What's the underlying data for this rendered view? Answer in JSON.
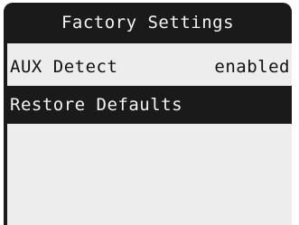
{
  "screen": {
    "title": "Factory Settings"
  },
  "menu": {
    "items": [
      {
        "label": "AUX Detect",
        "value": "enabled",
        "selected": false
      },
      {
        "label": "Restore Defaults",
        "value": "",
        "selected": true
      }
    ]
  }
}
